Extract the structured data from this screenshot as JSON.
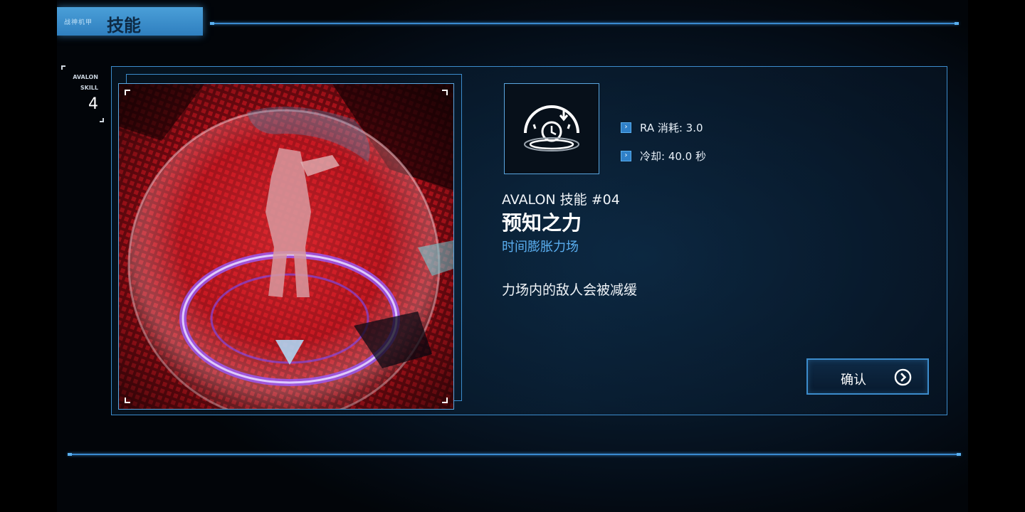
{
  "header": {
    "small_label": "战神机甲",
    "title": "技能"
  },
  "skill_index": {
    "line1": "AVALON",
    "line2": "SKILL",
    "number": "4"
  },
  "stats": {
    "ra_cost": "RA 消耗: 3.0",
    "cooldown": "冷却: 40.0 秒"
  },
  "skill": {
    "subtitle": "AVALON 技能 #04",
    "name": "预知之力",
    "type": "时间膨胀力场",
    "description": "力场内的敌人会被减缓"
  },
  "confirm": {
    "label": "确认"
  },
  "icons": {
    "skill_icon": "time-dilation-clock-icon",
    "stat_bullet": "chevron-right-icon",
    "confirm_arrow": "circled-chevron-right-icon"
  },
  "colors": {
    "accent": "#3c8ccc",
    "accent_light": "#5aaef0",
    "header_tab": "#4a9fd8"
  }
}
